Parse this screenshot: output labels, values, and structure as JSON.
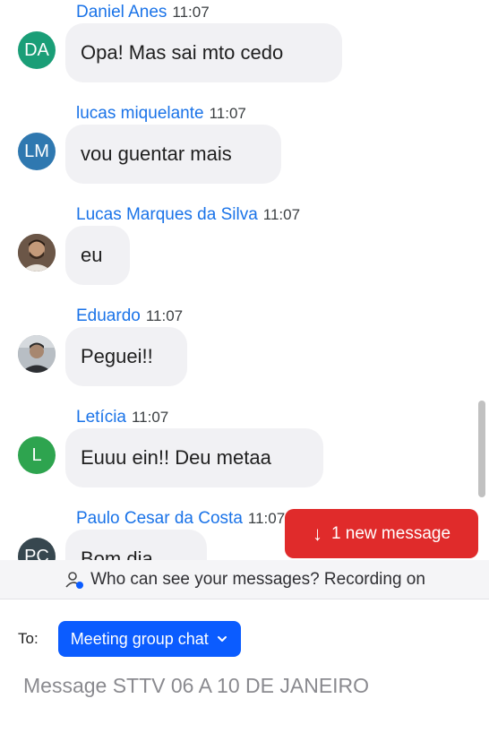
{
  "messages": [
    {
      "sender": "Daniel Anes",
      "time": "11:07",
      "text": "Opa! Mas sai mto cedo",
      "avatar": {
        "type": "initials",
        "initials": "DA",
        "color": "#1a9e77"
      }
    },
    {
      "sender": "lucas miquelante",
      "time": "11:07",
      "text": "vou guentar mais",
      "avatar": {
        "type": "initials",
        "initials": "LM",
        "color": "#2f78b0"
      }
    },
    {
      "sender": "Lucas Marques da Silva",
      "time": "11:07",
      "text": "eu",
      "avatar": {
        "type": "photo"
      }
    },
    {
      "sender": "Eduardo",
      "time": "11:07",
      "text": "Peguei!!",
      "avatar": {
        "type": "photo"
      }
    },
    {
      "sender": "Letícia",
      "time": "11:07",
      "text": "Euuu ein!! Deu metaa",
      "avatar": {
        "type": "initials",
        "initials": "L",
        "color": "#2ea44f"
      }
    },
    {
      "sender": "Paulo Cesar da Costa",
      "time": "11:07",
      "text": "Bom dia",
      "avatar": {
        "type": "initials",
        "initials": "PC",
        "color": "#37474f"
      }
    }
  ],
  "new_message_button": {
    "label": "1 new message",
    "icon": "arrow-down-icon"
  },
  "privacy_notice": {
    "text": "Who can see your messages? Recording on",
    "icon": "person-lock-icon"
  },
  "recipient": {
    "label": "To:",
    "selected": "Meeting group chat"
  },
  "compose": {
    "placeholder": "Message STTV 06 A 10 DE JANEIRO"
  },
  "colors": {
    "link": "#1a73e8",
    "bubble": "#f1f1f4",
    "alert": "#e02b2b",
    "primary": "#0b5cff"
  }
}
